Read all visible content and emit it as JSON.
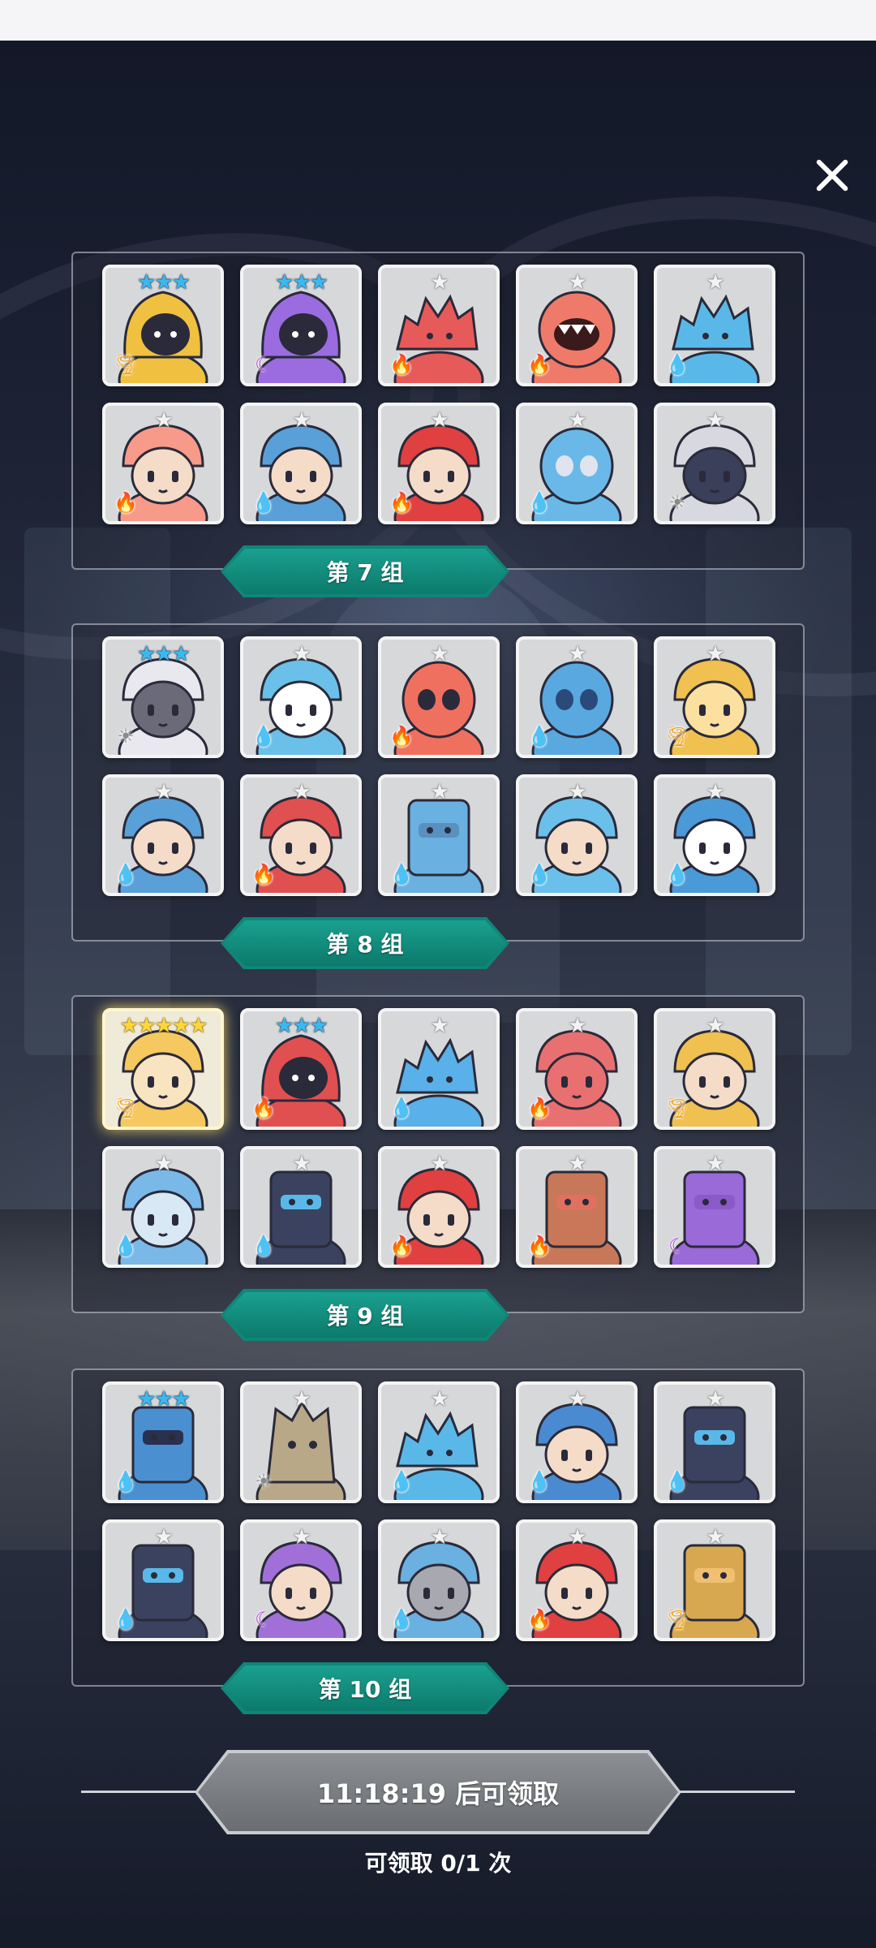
{
  "colors": {
    "accent_teal": "#0f8679",
    "card_bg": "#d7d8da",
    "star_blue": "#3bb8f0",
    "star_gold": "#ffd63a",
    "element_fire": "#e14a2a",
    "element_water": "#2f7fe6",
    "element_wind": "#f2a21b",
    "element_light": "#8a8a8a",
    "element_dark": "#b03ad8"
  },
  "close_icon": "close-icon",
  "groups": [
    {
      "label": "第 7 组",
      "units": [
        {
          "stars": 3,
          "element": "wind",
          "body": "#f0c040",
          "head": "#2a2a3a",
          "shape": "hood"
        },
        {
          "stars": 3,
          "element": "dark",
          "body": "#9a6ce0",
          "head": "#2a2a3a",
          "shape": "hood"
        },
        {
          "stars": 1,
          "element": "fire",
          "body": "#e65a5a",
          "head": "#e65a5a",
          "shape": "blob"
        },
        {
          "stars": 1,
          "element": "fire",
          "body": "#f07a6a",
          "head": "#ffffff",
          "shape": "mouth"
        },
        {
          "stars": 1,
          "element": "water",
          "body": "#5ab8e8",
          "head": "#5ab8e8",
          "shape": "dragon"
        },
        {
          "stars": 1,
          "element": "fire",
          "body": "#f79a8a",
          "head": "#f4dcc8",
          "shape": "fox"
        },
        {
          "stars": 1,
          "element": "water",
          "body": "#5aa0d8",
          "head": "#f4dcc8",
          "shape": "knight"
        },
        {
          "stars": 1,
          "element": "fire",
          "body": "#e04040",
          "head": "#f4dcc8",
          "shape": "card"
        },
        {
          "stars": 1,
          "element": "water",
          "body": "#6ab8e8",
          "head": "#e0e4ee",
          "shape": "ghost"
        },
        {
          "stars": 1,
          "element": "light",
          "body": "#d8d8e0",
          "head": "#3a3f5a",
          "shape": "angel"
        }
      ]
    },
    {
      "label": "第 8 组",
      "units": [
        {
          "stars": 3,
          "element": "light",
          "body": "#e8e8ee",
          "head": "#6a6a78",
          "shape": "wolf"
        },
        {
          "stars": 1,
          "element": "water",
          "body": "#6ac0e8",
          "head": "#ffffff",
          "shape": "mummy"
        },
        {
          "stars": 1,
          "element": "fire",
          "body": "#f07060",
          "head": "#2a2a3a",
          "shape": "skull"
        },
        {
          "stars": 1,
          "element": "water",
          "body": "#5aa8e0",
          "head": "#2a4a7a",
          "shape": "skull"
        },
        {
          "stars": 1,
          "element": "wind",
          "body": "#f0c050",
          "head": "#fbe0a0",
          "shape": "dog"
        },
        {
          "stars": 1,
          "element": "water",
          "body": "#5aa0d8",
          "head": "#f4dcc8",
          "shape": "knight"
        },
        {
          "stars": 1,
          "element": "fire",
          "body": "#e05050",
          "head": "#f4dcc8",
          "shape": "helmet"
        },
        {
          "stars": 1,
          "element": "water",
          "body": "#6ab0e0",
          "head": "#5a90c0",
          "shape": "moai"
        },
        {
          "stars": 1,
          "element": "water",
          "body": "#6ac0ea",
          "head": "#f4dcc8",
          "shape": "fairy"
        },
        {
          "stars": 1,
          "element": "water",
          "body": "#4a9ad8",
          "head": "#ffffff",
          "shape": "fish"
        }
      ]
    },
    {
      "label": "第 9 组",
      "units": [
        {
          "stars": 5,
          "element": "wind",
          "body": "#f5c860",
          "head": "#f8e4c0",
          "shape": "girl"
        },
        {
          "stars": 3,
          "element": "fire",
          "body": "#e05050",
          "head": "#2a2a3a",
          "shape": "hood"
        },
        {
          "stars": 1,
          "element": "water",
          "body": "#5ab0e8",
          "head": "#5ab0e8",
          "shape": "blob"
        },
        {
          "stars": 1,
          "element": "fire",
          "body": "#e87070",
          "head": "#e87070",
          "shape": "cactus"
        },
        {
          "stars": 1,
          "element": "wind",
          "body": "#f0c050",
          "head": "#f4dcc8",
          "shape": "fox"
        },
        {
          "stars": 1,
          "element": "water",
          "body": "#7ab8e8",
          "head": "#d8e8f4",
          "shape": "snow"
        },
        {
          "stars": 1,
          "element": "water",
          "body": "#3a4260",
          "head": "#5ab8e8",
          "shape": "block"
        },
        {
          "stars": 1,
          "element": "fire",
          "body": "#e04040",
          "head": "#f4dcc8",
          "shape": "card"
        },
        {
          "stars": 1,
          "element": "fire",
          "body": "#c87858",
          "head": "#e07060",
          "shape": "totem"
        },
        {
          "stars": 1,
          "element": "dark",
          "body": "#9a6ad8",
          "head": "#8a5ac8",
          "shape": "totem"
        }
      ]
    },
    {
      "label": "第 10 组",
      "units": [
        {
          "stars": 3,
          "element": "water",
          "body": "#4a90d0",
          "head": "#2a3050",
          "shape": "book"
        },
        {
          "stars": 1,
          "element": "light",
          "body": "#b8a888",
          "head": "#a09070",
          "shape": "tree"
        },
        {
          "stars": 1,
          "element": "water",
          "body": "#5ab8e8",
          "head": "#5ab8e8",
          "shape": "dragon"
        },
        {
          "stars": 1,
          "element": "water",
          "body": "#4a8ad0",
          "head": "#f4dcc8",
          "shape": "witch"
        },
        {
          "stars": 1,
          "element": "water",
          "body": "#3a4260",
          "head": "#5ab8e8",
          "shape": "block"
        },
        {
          "stars": 1,
          "element": "water",
          "body": "#3a4260",
          "head": "#5ab8e8",
          "shape": "block"
        },
        {
          "stars": 1,
          "element": "dark",
          "body": "#a070d8",
          "head": "#f4dcc8",
          "shape": "girl"
        },
        {
          "stars": 1,
          "element": "water",
          "body": "#6ab0e0",
          "head": "#a8a8b0",
          "shape": "angel"
        },
        {
          "stars": 1,
          "element": "fire",
          "body": "#e04040",
          "head": "#f4dcc8",
          "shape": "card"
        },
        {
          "stars": 1,
          "element": "wind",
          "body": "#d8a850",
          "head": "#f0c070",
          "shape": "totem"
        }
      ]
    }
  ],
  "claim": {
    "button_label": "11:18:19 后可领取",
    "count_label": "可领取 0/1 次"
  }
}
